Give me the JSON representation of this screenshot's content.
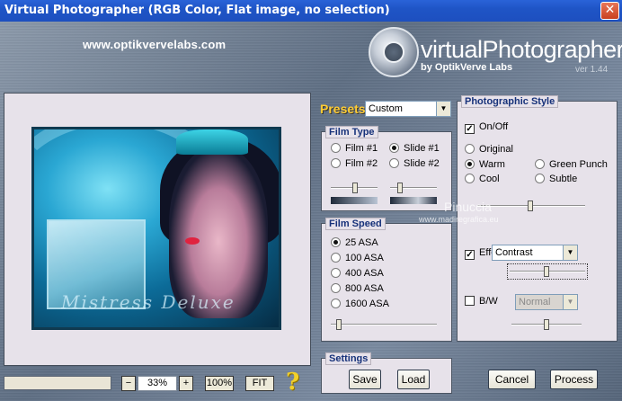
{
  "window": {
    "title": "Virtual Photographer (RGB Color, Flat image, no selection)",
    "close_glyph": "✕"
  },
  "header": {
    "url": "www.optikvervelabs.com",
    "logo_title": "virtualPhotographer",
    "logo_sub": "by OptikVerve Labs",
    "version": "ver 1.44"
  },
  "preview": {
    "image_text": "Mistress Deluxe"
  },
  "zoom": {
    "minus": "−",
    "value": "33%",
    "plus": "+",
    "full": "100%",
    "fit": "FIT",
    "help": "?"
  },
  "presets": {
    "label": "Presets",
    "selected": "Custom"
  },
  "film_type": {
    "title": "Film Type",
    "options": [
      "Film #1",
      "Slide #1",
      "Film #2",
      "Slide #2"
    ],
    "selected": "Slide #1"
  },
  "film_speed": {
    "title": "Film Speed",
    "options": [
      "25 ASA",
      "100 ASA",
      "400 ASA",
      "800 ASA",
      "1600 ASA"
    ],
    "selected": "25 ASA"
  },
  "settings": {
    "title": "Settings",
    "save": "Save",
    "load": "Load"
  },
  "style": {
    "title": "Photographic Style",
    "onoff_label": "On/Off",
    "onoff_checked": true,
    "options": [
      "Original",
      "Warm",
      "Green Punch",
      "Cool",
      "Subtle"
    ],
    "selected": "Warm",
    "effect_label": "Effect",
    "effect_checked": true,
    "effect_value": "Contrast",
    "bw_label": "B/W",
    "bw_checked": false,
    "bw_value": "Normal"
  },
  "watermark": {
    "name": "Pinuccia",
    "site": "www.madiregrafica.eu"
  },
  "actions": {
    "cancel": "Cancel",
    "process": "Process"
  },
  "colors": {
    "titlebar": "#2a63d8",
    "panel_bg": "#e7e2ea",
    "panel_title": "#17327a",
    "presets_label": "#ffcc33"
  }
}
